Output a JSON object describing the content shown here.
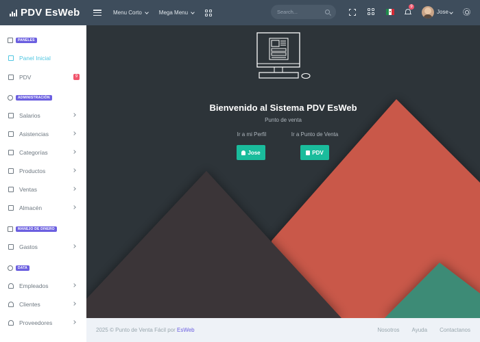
{
  "topbar": {
    "brand": "PDV EsWeb",
    "menu_corto": "Menu Corto",
    "mega_menu": "Mega Menu",
    "search_placeholder": "Search...",
    "notifications_count": "9",
    "user_name": "Jose",
    "icons": [
      "menu-icon",
      "apps-grid-icon",
      "search-icon",
      "fullscreen-icon",
      "flag-mexico-icon",
      "bell-icon",
      "settings-gear-icon"
    ]
  },
  "sidebar": {
    "sections": [
      {
        "title": "PANELES",
        "items": [
          {
            "label": "Panel Inicial",
            "active": true
          },
          {
            "label": "PDV",
            "badge": "9"
          }
        ]
      },
      {
        "title": "ADMINISTRACIÓN",
        "items": [
          {
            "label": "Salarios"
          },
          {
            "label": "Asistencias"
          },
          {
            "label": "Categorías"
          },
          {
            "label": "Productos"
          },
          {
            "label": "Ventas"
          },
          {
            "label": "Almacén"
          }
        ]
      },
      {
        "title": "MANEJO DE DINERO",
        "items": [
          {
            "label": "Gastos"
          }
        ]
      },
      {
        "title": "DATA",
        "items": [
          {
            "label": "Empleados"
          },
          {
            "label": "Clientes"
          },
          {
            "label": "Proveedores"
          }
        ]
      }
    ]
  },
  "main": {
    "title": "Bienvenido al Sistema PDV EsWeb",
    "subtitle": "Punto de venta",
    "profile_label": "Ir a mi Perfil",
    "profile_button": "Jose",
    "pos_label": "Ir a Punto de Venta",
    "pos_button": "PDV"
  },
  "footer": {
    "copyright": "2025 © Punto de Venta Fácil por ",
    "brand_link": "EsWeb",
    "links": [
      "Nosotros",
      "Ayuda",
      "Contactanos"
    ]
  },
  "colors": {
    "topbar": "#3e4d5c",
    "accent_teal": "#1abc9c",
    "accent_purple": "#6b5fe0",
    "badge_red": "#f1556c",
    "mountain_red": "#c9584a",
    "mountain_dark": "#3a3638",
    "mountain_green": "#3d8b76"
  }
}
